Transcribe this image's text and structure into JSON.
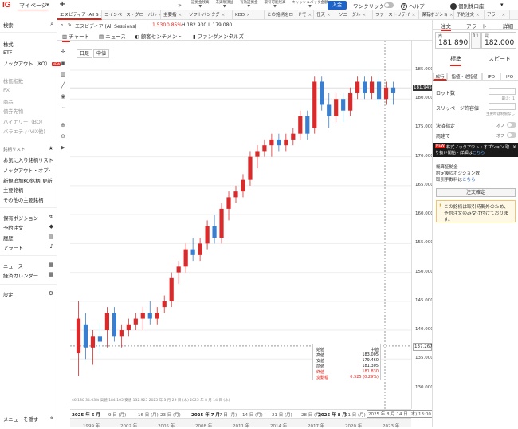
{
  "topbar": {
    "logo": "IG",
    "mypage": "マイページ",
    "nav": [
      {
        "l1": "証拠金残高",
        "l2": "▼"
      },
      {
        "l1": "未実現損益",
        "l2": "▼"
      },
      {
        "l1": "有効証拠金",
        "l2": "▼"
      },
      {
        "l1": "取引可能残高",
        "l2": "▼"
      },
      {
        "l1": "キャッシュバック金額",
        "l2": "▼"
      }
    ],
    "deposit": "入金",
    "oneclick": "ワンクリック",
    "help": "ヘルプ",
    "account": "個別株口座"
  },
  "tabs": [
    "エヌビディア (All S",
    "コインベース・グローバル",
    "主要指",
    "ソフトバンクグ",
    "KDD",
    "この銘柄をロードで",
    "任天",
    "ソニーグル",
    "ファーストリテイ",
    "保有ポジショ",
    "予約注文",
    "アラー"
  ],
  "sidebar": {
    "search": "検索",
    "items_a": [
      "株式",
      "ETF",
      "ノックアウト（KO）"
    ],
    "knock_badge": "NEW",
    "items_b": [
      "株価指数",
      "FX",
      "商品",
      "債券先物",
      "バイナリー（BO）",
      "バラエティ(VIX他)"
    ],
    "watch_title": "銘柄リスト",
    "watch": [
      "お気に入り銘柄リスト",
      "ノックアウト・オプ･",
      "新規追加KO銘柄(更新",
      "主要銘柄",
      "その他の主要銘柄"
    ],
    "pos": [
      "保有ポジション",
      "予約注文",
      "履歴",
      "アラート"
    ],
    "news": [
      "ニュース",
      "経済カレンダー"
    ],
    "settings": "設定",
    "hide": "メニューを隠す"
  },
  "chartbar": {
    "name": "エヌビディア (All Sessions)",
    "change": "1.530",
    "pct": "0.85%",
    "hl": "H 182.930 L 179.080"
  },
  "subtabs": [
    "チャート",
    "ニュース",
    "顧客センチメント",
    "ファンダメンタルズ"
  ],
  "interval": [
    "日足",
    "中値"
  ],
  "chart_data": {
    "type": "candlestick",
    "y_ticks": [
      185,
      180,
      175,
      170,
      165,
      160,
      155,
      150,
      145,
      140,
      135,
      130
    ],
    "ylim": [
      128,
      189
    ],
    "last_price": "181.945",
    "crosshair_price": "137.267",
    "x_labels": [
      "2025 年 6 月",
      "9 日 (月)",
      "16 日 (月)",
      "23 日 (月)",
      "2025 年 7 月",
      "7 日 (月)",
      "14 日 (月)",
      "21 日 (月)",
      "28 日 (月)",
      "2025 年 8 月",
      "11 日 (月)",
      "2025 年 8 月 14 日 (木) 13:00"
    ],
    "candles": [
      {
        "o": 136,
        "h": 145,
        "l": 132,
        "c": 142
      },
      {
        "o": 141,
        "h": 143,
        "l": 135,
        "c": 137
      },
      {
        "o": 137,
        "h": 140,
        "l": 134,
        "c": 139
      },
      {
        "o": 139,
        "h": 141,
        "l": 136,
        "c": 138
      },
      {
        "o": 140,
        "h": 144,
        "l": 137,
        "c": 143
      },
      {
        "o": 143,
        "h": 144,
        "l": 138,
        "c": 139
      },
      {
        "o": 139,
        "h": 141,
        "l": 137,
        "c": 140
      },
      {
        "o": 140,
        "h": 142,
        "l": 139,
        "c": 141
      },
      {
        "o": 141,
        "h": 143,
        "l": 140,
        "c": 142
      },
      {
        "o": 142,
        "h": 144,
        "l": 140,
        "c": 143
      },
      {
        "o": 143,
        "h": 145,
        "l": 141,
        "c": 142
      },
      {
        "o": 142,
        "h": 144,
        "l": 141,
        "c": 143
      },
      {
        "o": 144,
        "h": 146,
        "l": 143,
        "c": 145
      },
      {
        "o": 145,
        "h": 150,
        "l": 144,
        "c": 149
      },
      {
        "o": 150,
        "h": 152,
        "l": 148,
        "c": 151
      },
      {
        "o": 151,
        "h": 155,
        "l": 150,
        "c": 154
      },
      {
        "o": 154,
        "h": 156,
        "l": 152,
        "c": 153
      },
      {
        "o": 153,
        "h": 156,
        "l": 152,
        "c": 155
      },
      {
        "o": 155,
        "h": 159,
        "l": 154,
        "c": 158
      },
      {
        "o": 158,
        "h": 160,
        "l": 155,
        "c": 156
      },
      {
        "o": 156,
        "h": 162,
        "l": 155,
        "c": 161
      },
      {
        "o": 161,
        "h": 164,
        "l": 159,
        "c": 163
      },
      {
        "o": 163,
        "h": 165,
        "l": 162,
        "c": 164
      },
      {
        "o": 164,
        "h": 167,
        "l": 163,
        "c": 166
      },
      {
        "o": 166,
        "h": 171,
        "l": 165,
        "c": 170
      },
      {
        "o": 170,
        "h": 172,
        "l": 168,
        "c": 171
      },
      {
        "o": 171,
        "h": 173,
        "l": 170,
        "c": 172
      },
      {
        "o": 172,
        "h": 174,
        "l": 170,
        "c": 173
      },
      {
        "o": 173,
        "h": 174,
        "l": 171,
        "c": 172
      },
      {
        "o": 172,
        "h": 174,
        "l": 171,
        "c": 173
      },
      {
        "o": 173,
        "h": 175,
        "l": 172,
        "c": 174
      },
      {
        "o": 174,
        "h": 178,
        "l": 173,
        "c": 177
      },
      {
        "o": 177,
        "h": 178,
        "l": 173,
        "c": 174
      },
      {
        "o": 175,
        "h": 184,
        "l": 174,
        "c": 183
      },
      {
        "o": 183,
        "h": 184,
        "l": 178,
        "c": 179
      },
      {
        "o": 179,
        "h": 181,
        "l": 175,
        "c": 177
      },
      {
        "o": 177,
        "h": 181,
        "l": 176,
        "c": 180
      },
      {
        "o": 180,
        "h": 181,
        "l": 176,
        "c": 178
      },
      {
        "o": 178,
        "h": 182,
        "l": 177,
        "c": 181
      },
      {
        "o": 181,
        "h": 184,
        "l": 180,
        "c": 183
      },
      {
        "o": 183,
        "h": 184,
        "l": 180,
        "c": 181
      },
      {
        "o": 181,
        "h": 184,
        "l": 180,
        "c": 183
      },
      {
        "o": 183,
        "h": 184,
        "l": 179,
        "c": 180
      },
      {
        "o": 180,
        "h": 183,
        "l": 179,
        "c": 182
      },
      {
        "o": 182,
        "h": 183,
        "l": 179,
        "c": 181
      }
    ]
  },
  "infobox": {
    "title": "始値",
    "title2": "中値",
    "rows": [
      {
        "k": "高値",
        "v": "183.005"
      },
      {
        "k": "安値",
        "v": "179.460"
      },
      {
        "k": "前値",
        "v": "181.305"
      },
      {
        "k": "終値",
        "v": "181.830"
      },
      {
        "k": "変動幅",
        "v": "0.525 (0.29%)"
      }
    ]
  },
  "stats": "46.180 34.03% 高値 184.105 安値 132.925 2025 年 3 月 29 日 (木) 2025 年 8 月 14 日 (木)",
  "timeline": [
    "1999 年",
    "2002 年",
    "2005 年",
    "2008 年",
    "2011 年",
    "2014 年",
    "2017 年",
    "2020 年",
    "2023 年"
  ],
  "right": {
    "tabs": [
      "注文",
      "アラート",
      "詳細"
    ],
    "sell_label": "売",
    "buy_label": "買",
    "sell": "181.890",
    "buy": "182.000",
    "spread": "11",
    "types": [
      "標準",
      "スピード"
    ],
    "order_tabs": [
      "成行",
      "指値・逆指値",
      "IFD",
      "IFO"
    ],
    "lot": "ロット数",
    "min": "最少：1",
    "slip": "スリッページ許容値",
    "slip_sub": "主要時は制限なし",
    "settle": "決済指定",
    "close": "両建て",
    "off": "オフ",
    "banner_new": "NEW",
    "banner_1": "株式ノックアウト・オプション 取",
    "banner_2": "り扱い開始・詳細は",
    "banner_link": "こちら",
    "info_a": "概算証拠金",
    "info_b": "約定後のポジション数",
    "info_c": "取引手数料は",
    "info_link": "こちら",
    "confirm": "注文確定",
    "warn": "この銘柄は取引時間外のため、予約注文のみ受け付けております。"
  }
}
